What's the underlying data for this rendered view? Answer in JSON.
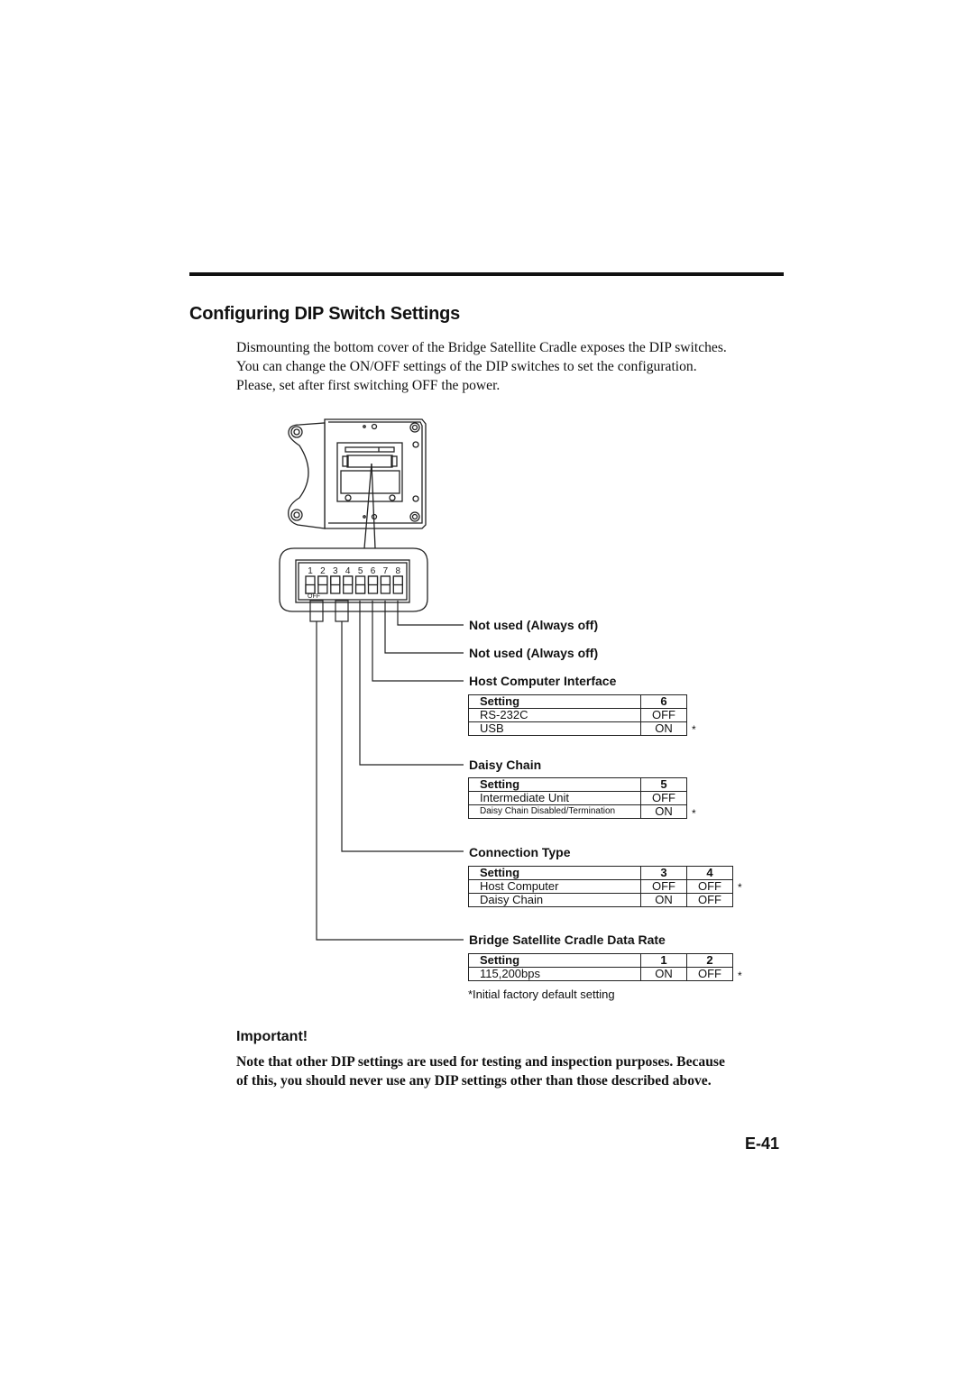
{
  "page": {
    "title": "Configuring DIP Switch Settings",
    "intro": [
      "Dismounting the bottom cover of the Bridge Satellite Cradle exposes the DIP switches.",
      "You can change the ON/OFF settings of the DIP switches to set the configuration.",
      "Please, set after first switching OFF the power."
    ],
    "page_number": "E-41"
  },
  "diagram": {
    "switch_numbers": [
      "1",
      "2",
      "3",
      "4",
      "5",
      "6",
      "7",
      "8"
    ],
    "off_label": "OFF",
    "switch_states": [
      "on",
      "off",
      "off",
      "off",
      "on",
      "off",
      "off",
      "off"
    ]
  },
  "sections": {
    "switch8": {
      "label": "Not used (Always off)"
    },
    "switch7": {
      "label": "Not used (Always off)"
    },
    "host_interface": {
      "label": "Host Computer Interface",
      "header": [
        "Setting",
        "6"
      ],
      "rows": [
        {
          "setting": "RS-232C",
          "values": [
            "OFF"
          ],
          "default": false
        },
        {
          "setting": "USB",
          "values": [
            "ON"
          ],
          "default": true
        }
      ]
    },
    "daisy_chain": {
      "label": "Daisy Chain",
      "header": [
        "Setting",
        "5"
      ],
      "rows": [
        {
          "setting": "Intermediate Unit",
          "values": [
            "OFF"
          ],
          "default": false
        },
        {
          "setting": "Daisy Chain Disabled/Termination",
          "values": [
            "ON"
          ],
          "default": true
        }
      ]
    },
    "connection_type": {
      "label": "Connection Type",
      "header": [
        "Setting",
        "3",
        "4"
      ],
      "rows": [
        {
          "setting": "Host Computer",
          "values": [
            "OFF",
            "OFF"
          ],
          "default": true
        },
        {
          "setting": "Daisy Chain",
          "values": [
            "ON",
            "OFF"
          ],
          "default": false
        }
      ]
    },
    "data_rate": {
      "label": "Bridge Satellite Cradle Data Rate",
      "header": [
        "Setting",
        "1",
        "2"
      ],
      "rows": [
        {
          "setting": "115,200bps",
          "values": [
            "ON",
            "OFF"
          ],
          "default": true
        }
      ]
    },
    "default_marker": "*",
    "footnote": "*Initial factory default setting"
  },
  "important": {
    "heading": "Important!",
    "text": [
      "Note that other DIP settings are used for testing and inspection purposes. Because",
      "of this, you should never use any DIP settings other than those described above."
    ]
  }
}
